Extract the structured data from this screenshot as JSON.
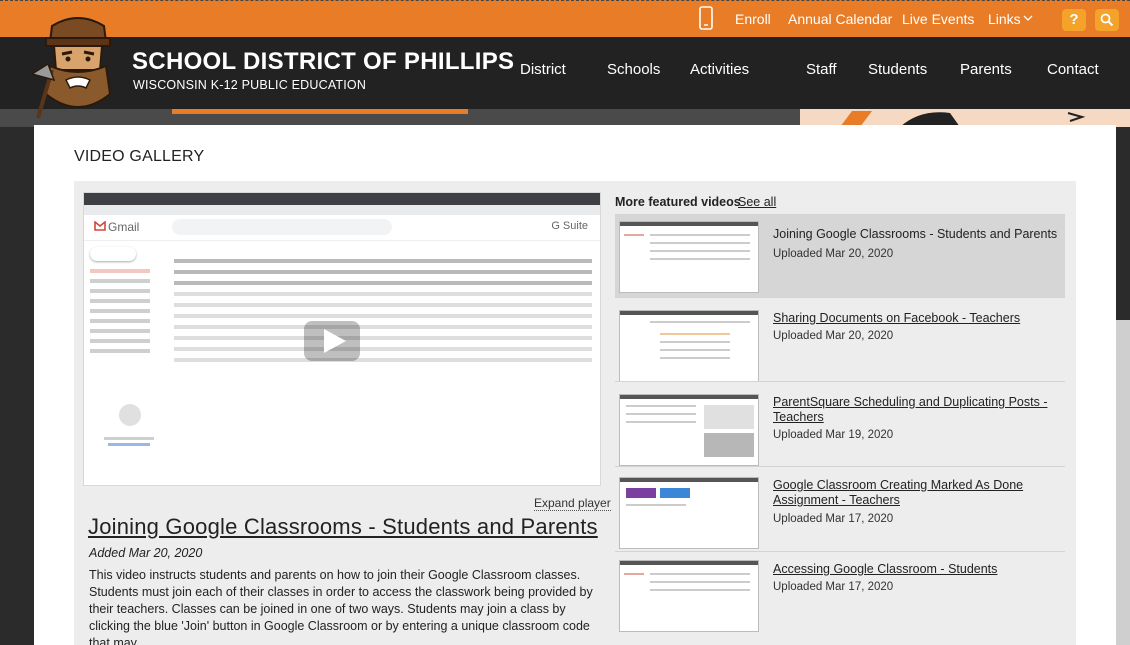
{
  "utility_bar": {
    "enroll": "Enroll",
    "annual_calendar": "Annual Calendar",
    "live_events": "Live Events",
    "links": "Links",
    "help": "?"
  },
  "header": {
    "title": "SCHOOL DISTRICT OF PHILLIPS",
    "subtitle": "WISCONSIN K-12 PUBLIC EDUCATION",
    "nav": [
      "District",
      "Schools",
      "Activities",
      "Staff",
      "Students",
      "Parents",
      "Contact"
    ]
  },
  "gallery": {
    "heading": "VIDEO GALLERY",
    "expand_player": "Expand player",
    "current": {
      "title": "Joining Google Classrooms - Students and Parents",
      "added": "Added Mar 20, 2020",
      "description": "This video instructs students and parents on how to join their Google Classroom classes. Students must join each of their classes in order to access the classwork being provided by their teachers. Classes can be joined in one of two ways. Students may join a class by clicking the blue 'Join' button in Google Classroom or by entering a unique classroom code that may"
    },
    "player_screenshot": {
      "app_name": "Gmail",
      "suite_label": "G Suite"
    },
    "featured": {
      "heading": "More featured videos",
      "see_all": "See all",
      "items": [
        {
          "title": "Joining Google Classrooms - Students and Parents",
          "uploaded": "Uploaded Mar 20, 2020"
        },
        {
          "title": "Sharing Documents on Facebook - Teachers",
          "uploaded": "Uploaded Mar 20, 2020"
        },
        {
          "title": "ParentSquare Scheduling and Duplicating Posts - Teachers",
          "uploaded": "Uploaded Mar 19, 2020"
        },
        {
          "title": "Google Classroom Creating Marked As Done Assignment - Teachers",
          "uploaded": "Uploaded Mar 17, 2020"
        },
        {
          "title": "Accessing Google Classroom - Students",
          "uploaded": "Uploaded Mar 17, 2020"
        }
      ]
    }
  },
  "colors": {
    "brand_orange": "#e87c27",
    "header_dark": "#222222",
    "button_orange": "#f5a22b"
  }
}
